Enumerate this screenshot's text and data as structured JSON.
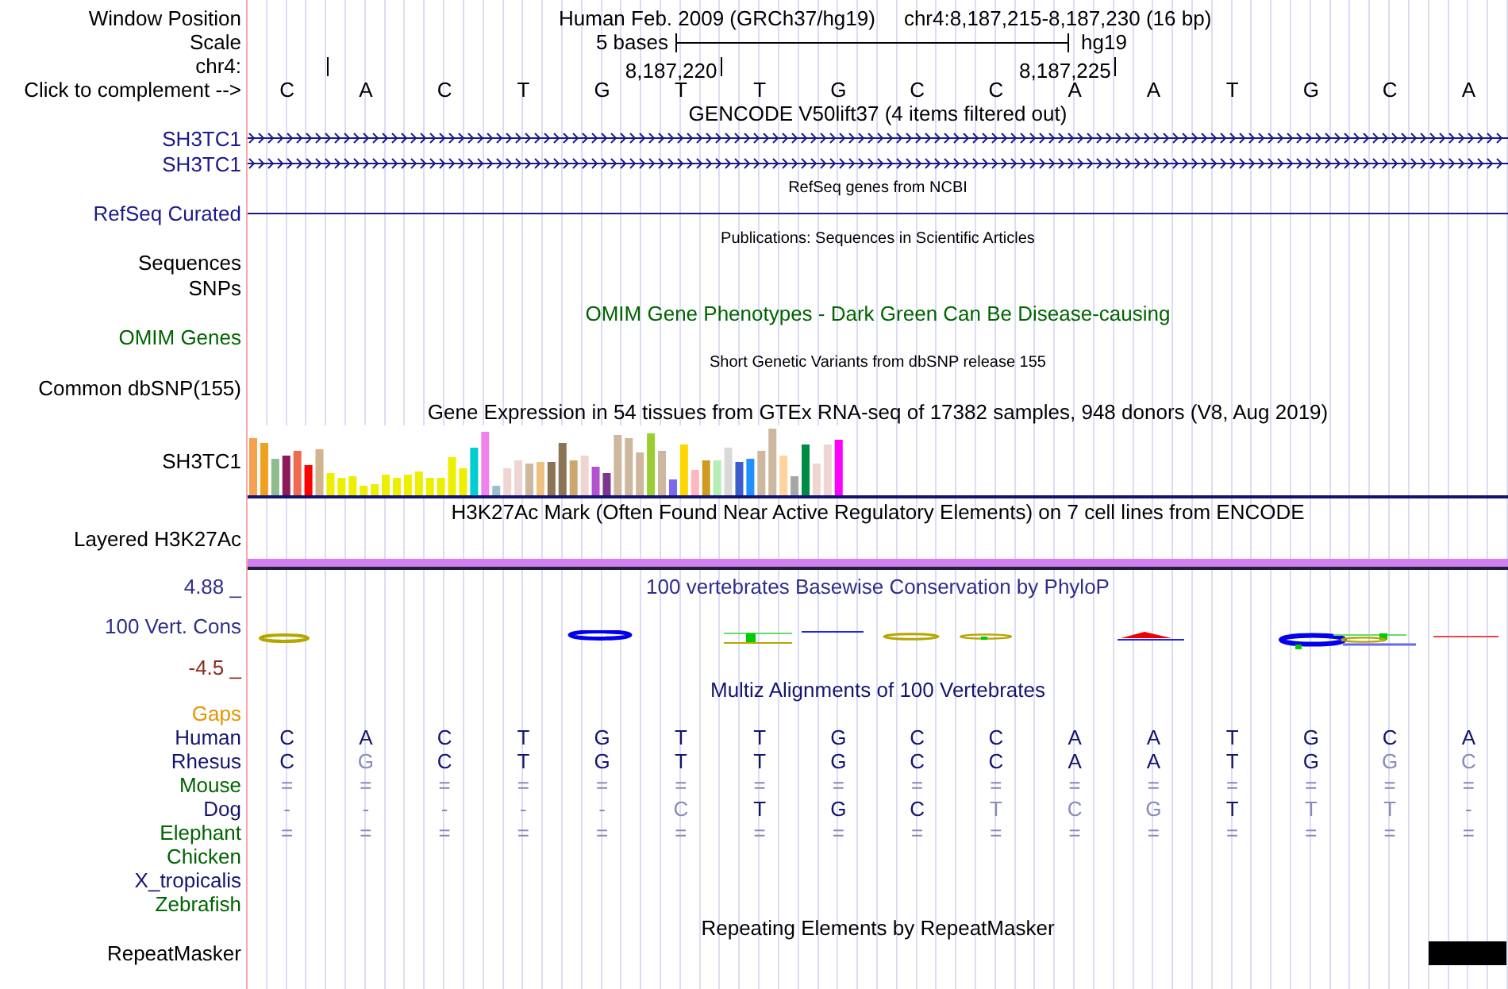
{
  "header": [
    {
      "kind": "position",
      "label": "Window Position",
      "assembly": "Human Feb. 2009 (GRCh37/hg19)",
      "range": "chr4:8,187,215-8,187,230 (16 bp)"
    },
    {
      "kind": "scale",
      "label": "Scale",
      "span": "5 bases",
      "db": "hg19"
    },
    {
      "kind": "ruler",
      "label": "chr4:",
      "ticks": [
        "8,187,220",
        "8,187,225"
      ]
    },
    {
      "kind": "bases",
      "label": "Click to complement -->",
      "bases": [
        "C",
        "A",
        "C",
        "T",
        "G",
        "T",
        "T",
        "G",
        "C",
        "C",
        "A",
        "A",
        "T",
        "G",
        "C",
        "A"
      ]
    }
  ],
  "tracks": [
    {
      "kind": "gene",
      "title": {
        "text": "GENCODE V50lift37 (4 items filtered out)",
        "kind": "heading",
        "color": "#000000"
      },
      "rows": [
        {
          "label": "SH3TC1",
          "color": "#1a1a8c"
        },
        {
          "label": "SH3TC1",
          "color": "#1a1a8c"
        }
      ]
    },
    {
      "kind": "line",
      "title": {
        "text": "RefSeq genes from NCBI",
        "kind": "note",
        "color": "#000000"
      },
      "rows": [
        {
          "label": "RefSeq Curated",
          "color": "#1a1a8c"
        }
      ]
    },
    {
      "kind": "empty",
      "title": {
        "text": "Publications: Sequences in Scientific Articles",
        "kind": "note",
        "color": "#000000"
      },
      "rows": [
        {
          "label": "Sequences",
          "color": "#000000"
        },
        {
          "label": "SNPs",
          "color": "#000000"
        }
      ]
    },
    {
      "kind": "empty",
      "title": {
        "text": "OMIM Gene Phenotypes - Dark Green Can Be Disease-causing",
        "kind": "heading",
        "color": "#006400"
      },
      "rows": [
        {
          "label": "OMIM Genes",
          "color": "#006400"
        }
      ]
    },
    {
      "kind": "empty",
      "title": {
        "text": "Short Genetic Variants from dbSNP release 155",
        "kind": "note",
        "color": "#000000"
      },
      "rows": [
        {
          "label": "Common dbSNP(155)",
          "color": "#000000"
        }
      ]
    },
    {
      "kind": "bars",
      "title": {
        "text": "Gene Expression in 54 tissues from GTEx RNA-seq of 17382 samples, 948 donors (V8, Aug 2019)",
        "kind": "heading",
        "color": "#000000"
      },
      "rows": [
        {
          "label": "SH3TC1",
          "color": "#000000"
        }
      ]
    },
    {
      "kind": "layered",
      "title": {
        "text": "H3K27Ac Mark (Often Found Near Active Regulatory Elements) on 7 cell lines from ENCODE",
        "kind": "heading",
        "color": "#000000"
      },
      "rows": [
        {
          "label": "Layered H3K27Ac",
          "color": "#000000"
        }
      ]
    },
    {
      "kind": "phylop",
      "title": {
        "text": "100 vertebrates Basewise Conservation by PhyloP",
        "kind": "heading",
        "color": "#2e2e8a"
      },
      "rows": [
        {
          "label": "100 Vert. Cons",
          "color": "#2e2e8a"
        }
      ],
      "max": "4.88 _",
      "min": "-4.5 _"
    },
    {
      "kind": "multiz",
      "title": {
        "text": "Multiz Alignments of 100 Vertebrates",
        "kind": "heading",
        "color": "#14146e"
      },
      "rows": [
        {
          "label": "Gaps",
          "color": "#e69500"
        },
        {
          "label": "Human",
          "color": "#14146e",
          "cells": [
            {
              "text": "C",
              "match": true
            },
            {
              "text": "A",
              "match": true
            },
            {
              "text": "C",
              "match": true
            },
            {
              "text": "T",
              "match": true
            },
            {
              "text": "G",
              "match": true
            },
            {
              "text": "T",
              "match": true
            },
            {
              "text": "T",
              "match": true
            },
            {
              "text": "G",
              "match": true
            },
            {
              "text": "C",
              "match": true
            },
            {
              "text": "C",
              "match": true
            },
            {
              "text": "A",
              "match": true
            },
            {
              "text": "A",
              "match": true
            },
            {
              "text": "T",
              "match": true
            },
            {
              "text": "G",
              "match": true
            },
            {
              "text": "C",
              "match": true
            },
            {
              "text": "A",
              "match": true
            }
          ]
        },
        {
          "label": "Rhesus",
          "color": "#14146e",
          "cells": [
            {
              "text": "C",
              "match": true
            },
            {
              "text": "G",
              "match": false
            },
            {
              "text": "C",
              "match": true
            },
            {
              "text": "T",
              "match": true
            },
            {
              "text": "G",
              "match": true
            },
            {
              "text": "T",
              "match": true
            },
            {
              "text": "T",
              "match": true
            },
            {
              "text": "G",
              "match": true
            },
            {
              "text": "C",
              "match": true
            },
            {
              "text": "C",
              "match": true
            },
            {
              "text": "A",
              "match": true
            },
            {
              "text": "A",
              "match": true
            },
            {
              "text": "T",
              "match": true
            },
            {
              "text": "G",
              "match": true
            },
            {
              "text": "G",
              "match": false
            },
            {
              "text": "C",
              "match": false
            }
          ]
        },
        {
          "label": "Mouse",
          "color": "#006400",
          "cells": [
            {
              "text": "=",
              "match": false
            },
            {
              "text": "=",
              "match": false
            },
            {
              "text": "=",
              "match": false
            },
            {
              "text": "=",
              "match": false
            },
            {
              "text": "=",
              "match": false
            },
            {
              "text": "=",
              "match": false
            },
            {
              "text": "=",
              "match": false
            },
            {
              "text": "=",
              "match": false
            },
            {
              "text": "=",
              "match": false
            },
            {
              "text": "=",
              "match": false
            },
            {
              "text": "=",
              "match": false
            },
            {
              "text": "=",
              "match": false
            },
            {
              "text": "=",
              "match": false
            },
            {
              "text": "=",
              "match": false
            },
            {
              "text": "=",
              "match": false
            },
            {
              "text": "=",
              "match": false
            }
          ]
        },
        {
          "label": "Dog",
          "color": "#14146e",
          "cells": [
            {
              "text": "-",
              "match": false
            },
            {
              "text": "-",
              "match": false
            },
            {
              "text": "-",
              "match": false
            },
            {
              "text": "-",
              "match": false
            },
            {
              "text": "-",
              "match": false
            },
            {
              "text": "C",
              "match": false
            },
            {
              "text": "T",
              "match": true
            },
            {
              "text": "G",
              "match": true
            },
            {
              "text": "C",
              "match": true
            },
            {
              "text": "T",
              "match": false
            },
            {
              "text": "C",
              "match": false
            },
            {
              "text": "G",
              "match": false
            },
            {
              "text": "T",
              "match": true
            },
            {
              "text": "T",
              "match": false
            },
            {
              "text": "T",
              "match": false
            },
            {
              "text": "-",
              "match": false
            }
          ]
        },
        {
          "label": "Elephant",
          "color": "#006400",
          "cells": [
            {
              "text": "=",
              "match": false
            },
            {
              "text": "=",
              "match": false
            },
            {
              "text": "=",
              "match": false
            },
            {
              "text": "=",
              "match": false
            },
            {
              "text": "=",
              "match": false
            },
            {
              "text": "=",
              "match": false
            },
            {
              "text": "=",
              "match": false
            },
            {
              "text": "=",
              "match": false
            },
            {
              "text": "=",
              "match": false
            },
            {
              "text": "=",
              "match": false
            },
            {
              "text": "=",
              "match": false
            },
            {
              "text": "=",
              "match": false
            },
            {
              "text": "=",
              "match": false
            },
            {
              "text": "=",
              "match": false
            },
            {
              "text": "=",
              "match": false
            },
            {
              "text": "=",
              "match": false
            }
          ]
        },
        {
          "label": "Chicken",
          "color": "#006400"
        },
        {
          "label": "X_tropicalis",
          "color": "#14146e"
        },
        {
          "label": "Zebrafish",
          "color": "#006400"
        }
      ]
    },
    {
      "kind": "repeat",
      "title": {
        "text": "Repeating Elements by RepeatMasker",
        "kind": "heading",
        "color": "#000000"
      },
      "rows": [
        {
          "label": "RepeatMasker",
          "color": "#000000"
        }
      ]
    }
  ]
}
